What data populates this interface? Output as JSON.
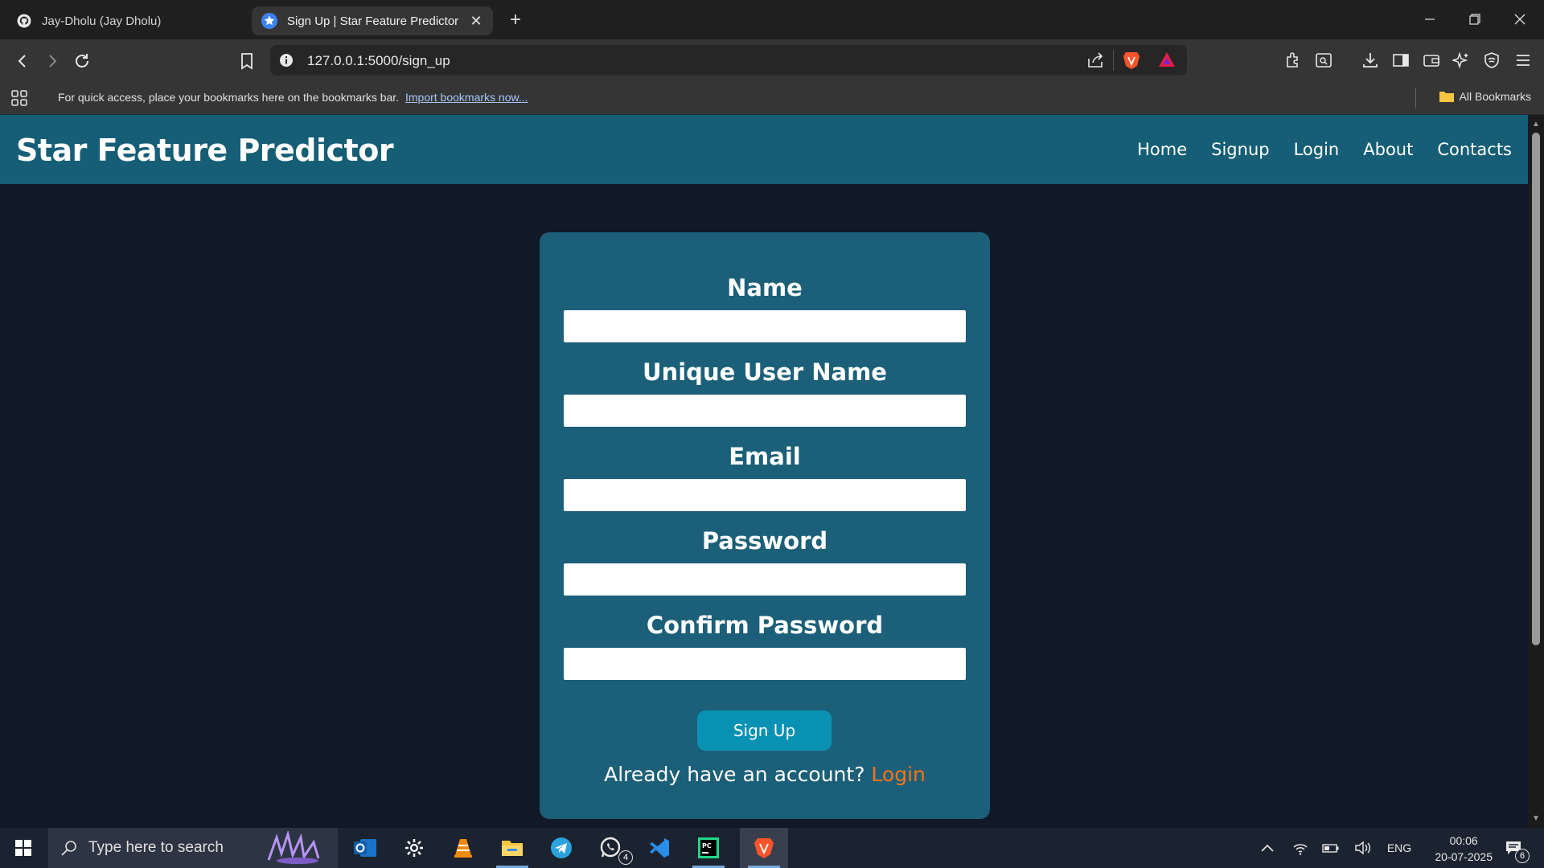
{
  "browser": {
    "tabs": [
      {
        "label": "Jay-Dholu (Jay Dholu)",
        "icon": "github-icon"
      },
      {
        "label": "Sign Up | Star Feature Predictor",
        "icon": "star-icon",
        "active": true
      }
    ],
    "url": "127.0.0.1:5000/sign_up",
    "bookmarks_bar": {
      "message": "For quick access, place your bookmarks here on the bookmarks bar.",
      "import_link": "Import bookmarks now...",
      "all_bookmarks": "All Bookmarks"
    }
  },
  "site": {
    "brand": "Star Feature Predictor",
    "nav": [
      "Home",
      "Signup",
      "Login",
      "About",
      "Contacts"
    ]
  },
  "form": {
    "fields": [
      {
        "label": "Name",
        "value": ""
      },
      {
        "label": "Unique User Name",
        "value": ""
      },
      {
        "label": "Email",
        "value": ""
      },
      {
        "label": "Password",
        "value": ""
      },
      {
        "label": "Confirm Password",
        "value": ""
      }
    ],
    "submit_label": "Sign Up",
    "already_text": "Already have an account?",
    "login_link": "Login"
  },
  "taskbar": {
    "search_placeholder": "Type here to search",
    "whatsapp_badge": "4",
    "language": "ENG",
    "time": "00:06",
    "date": "20-07-2025",
    "notifications": "6"
  },
  "colors": {
    "navbar": "#155e75",
    "card": "#1b5f78",
    "page_bg": "#111827",
    "button": "#0891b2",
    "link": "#f97316"
  }
}
